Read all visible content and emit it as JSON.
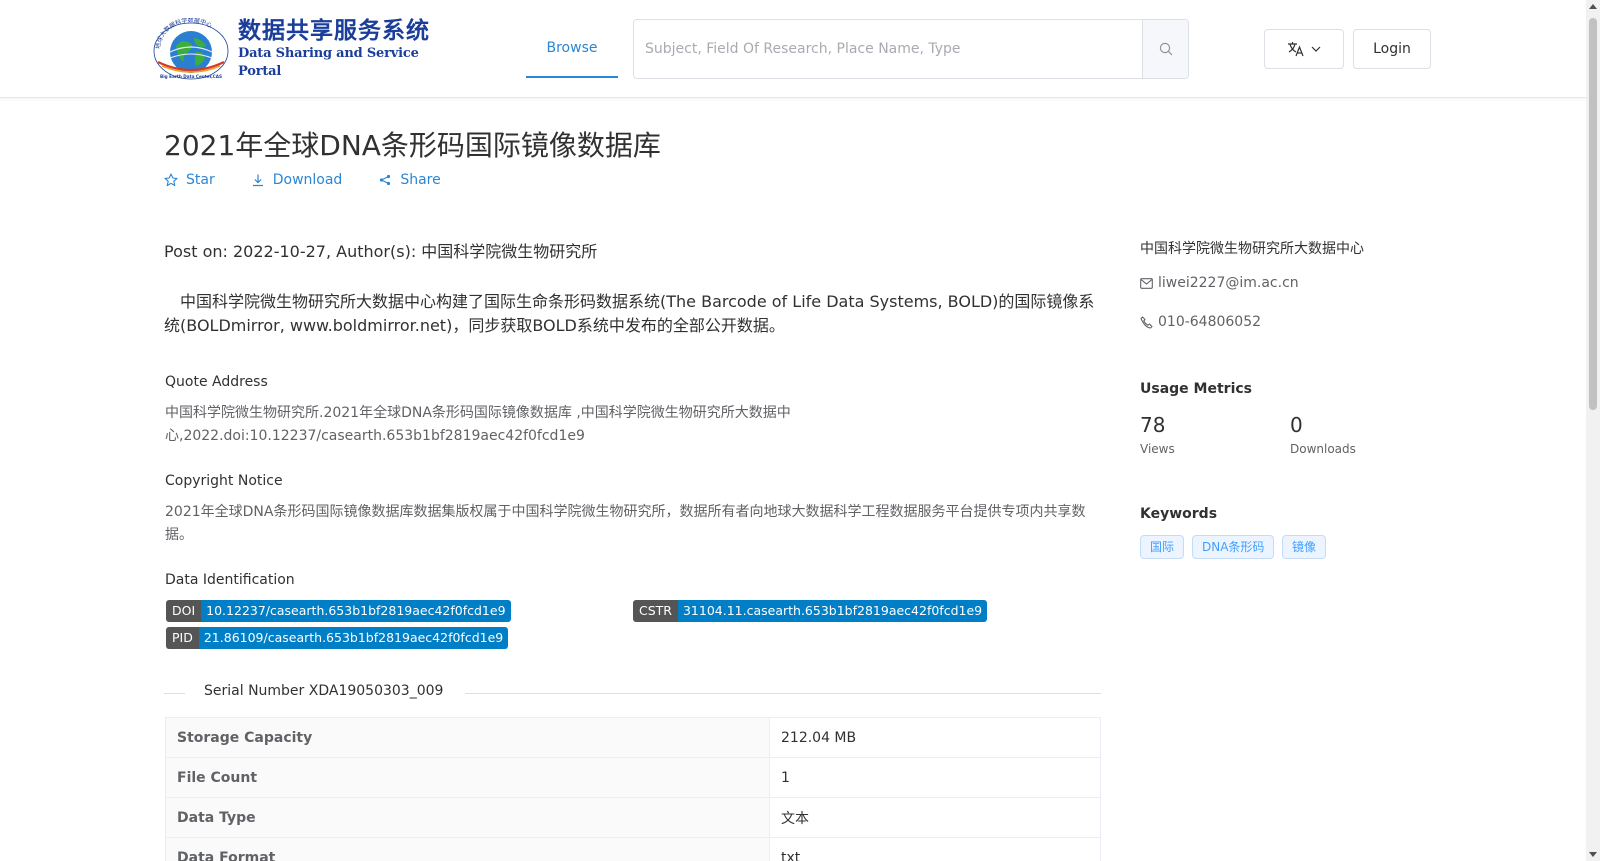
{
  "header": {
    "logo": {
      "cn_text": "数据共享服务系统",
      "en_text": "Data Sharing and Service Portal",
      "ring_text": "地球大数据科学数据中心 Big Earth Data Center,CAS"
    },
    "nav": {
      "browse_label": "Browse"
    },
    "search": {
      "placeholder": "Subject, Field Of Research, Place Name, Type",
      "value": ""
    },
    "login_label": "Login"
  },
  "dataset": {
    "title": "2021年全球DNA条形码国际镜像数据库",
    "actions": {
      "star": "Star",
      "download": "Download",
      "share": "Share"
    },
    "post_meta": "Post on: 2022-10-27, Author(s): 中国科学院微生物研究所",
    "description": "中国科学院微生物研究所大数据中心构建了国际生命条形码数据系统(The Barcode of Life Data Systems, BOLD)的国际镜像系统(BOLDmirror, www.boldmirror.net)，同步获取BOLD系统中发布的全部公开数据。",
    "quote": {
      "label": "Quote Address",
      "text_line1": "中国科学院微生物研究所.2021年全球DNA条形码国际镜像数据库 ,中国科学院微生物研究所大数据中",
      "text_line2": "心,2022.doi:10.12237/casearth.653b1bf2819aec42f0fcd1e9"
    },
    "copyright": {
      "label": "Copyright Notice",
      "text": "2021年全球DNA条形码国际镜像数据库数据集版权属于中国科学院微生物研究所，数据所有者向地球大数据科学工程数据服务平台提供专项内共享数据。"
    },
    "identification": {
      "label": "Data Identification",
      "doi": {
        "key": "DOI",
        "value": "10.12237/casearth.653b1bf2819aec42f0fcd1e9"
      },
      "cstr": {
        "key": "CSTR",
        "value": "31104.11.casearth.653b1bf2819aec42f0fcd1e9"
      },
      "pid": {
        "key": "PID",
        "value": "21.86109/casearth.653b1bf2819aec42f0fcd1e9"
      }
    },
    "serial_number": "Serial Number XDA19050303_009",
    "properties": [
      {
        "key": "Storage Capacity",
        "value": "212.04 MB"
      },
      {
        "key": "File Count",
        "value": "1"
      },
      {
        "key": "Data Type",
        "value": "文本"
      },
      {
        "key": "Data Format",
        "value": "txt"
      }
    ]
  },
  "sidebar": {
    "org": "中国科学院微生物研究所大数据中心",
    "email": "liwei2227@im.ac.cn",
    "phone": "010-64806052",
    "metrics": {
      "heading": "Usage Metrics",
      "views_value": "78",
      "views_label": "Views",
      "downloads_value": "0",
      "downloads_label": "Downloads"
    },
    "keywords": {
      "heading": "Keywords",
      "items": [
        "国际",
        "DNA条形码",
        "镜像"
      ]
    }
  },
  "colors": {
    "accent": "#2b86d6",
    "tag_key": "#555555",
    "tag_value": "#007ec6",
    "keyword": "#409eff"
  }
}
